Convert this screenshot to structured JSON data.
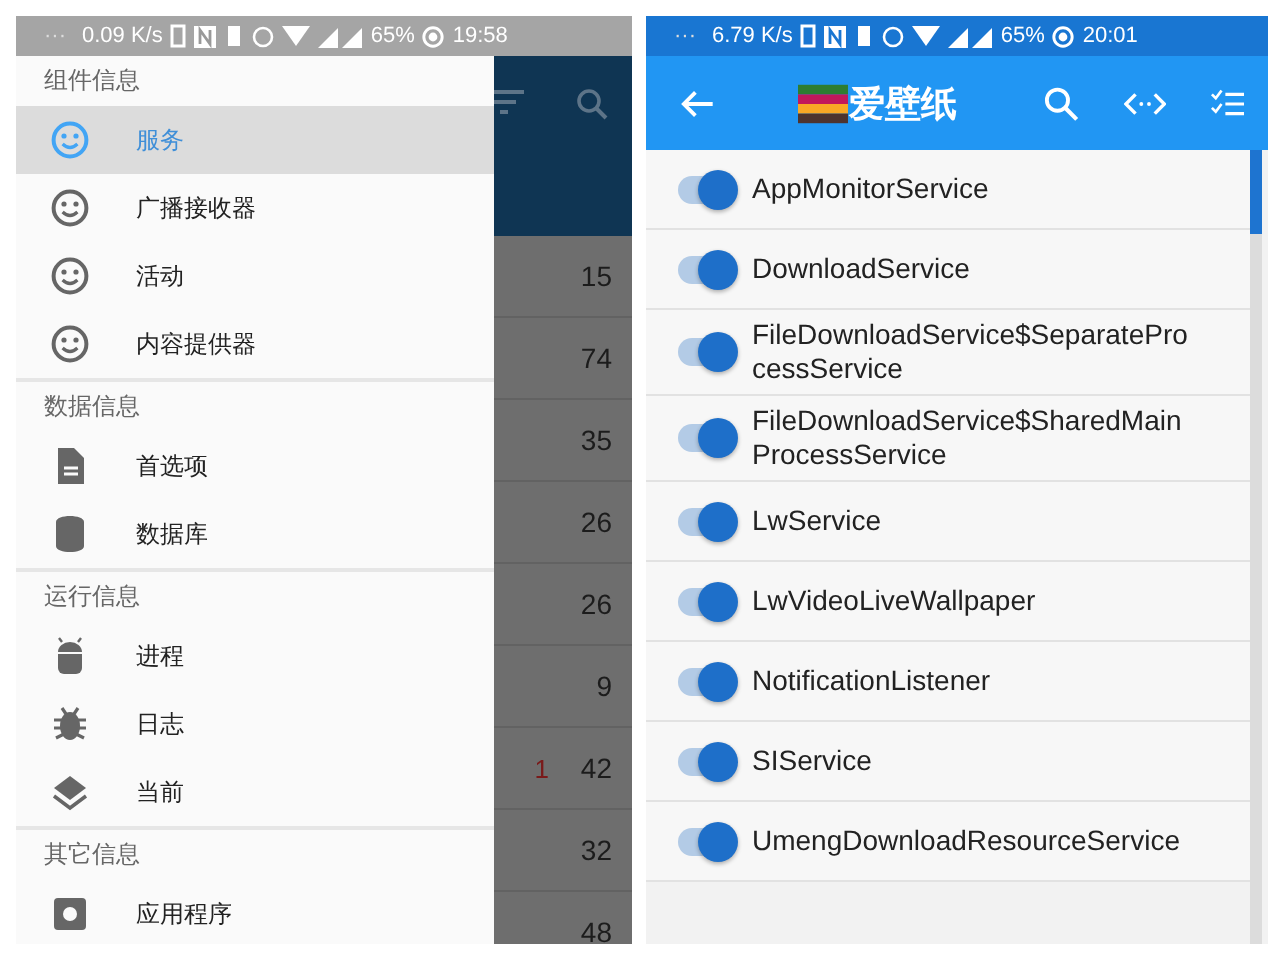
{
  "left_phone": {
    "status_bar": {
      "overflow": "···",
      "speed": "0.09 K/s",
      "battery": "65%",
      "time": "19:58"
    },
    "drawer": {
      "sections": [
        {
          "title": "组件信息",
          "items": [
            {
              "label": "服务",
              "kind": "smiley",
              "selected": true
            },
            {
              "label": "广播接收器",
              "kind": "smiley",
              "selected": false
            },
            {
              "label": "活动",
              "kind": "smiley",
              "selected": false
            },
            {
              "label": "内容提供器",
              "kind": "smiley",
              "selected": false
            }
          ]
        },
        {
          "title": "数据信息",
          "items": [
            {
              "label": "首选项",
              "kind": "document",
              "selected": false
            },
            {
              "label": "数据库",
              "kind": "database",
              "selected": false
            }
          ]
        },
        {
          "title": "运行信息",
          "items": [
            {
              "label": "进程",
              "kind": "android",
              "selected": false
            },
            {
              "label": "日志",
              "kind": "bug",
              "selected": false
            },
            {
              "label": "当前",
              "kind": "layers",
              "selected": false
            }
          ]
        },
        {
          "title": "其它信息",
          "items": [
            {
              "label": "应用程序",
              "kind": "settings",
              "selected": false
            }
          ]
        }
      ]
    },
    "background_list": {
      "rows": [
        {
          "count": "15"
        },
        {
          "count": "74"
        },
        {
          "count": "35"
        },
        {
          "count": "26"
        },
        {
          "count": "26"
        },
        {
          "count": "9"
        },
        {
          "badge": "1",
          "count": "42"
        },
        {
          "count": "32"
        },
        {
          "count": "48"
        }
      ]
    }
  },
  "right_phone": {
    "status_bar": {
      "overflow": "···",
      "speed": "6.79 K/s",
      "battery": "65%",
      "time": "20:01"
    },
    "app_bar": {
      "title": "爱壁纸"
    },
    "services": [
      {
        "name": "AppMonitorService",
        "on": true
      },
      {
        "name": "DownloadService",
        "on": true
      },
      {
        "name": "FileDownloadService$SeparateProcessService",
        "on": true
      },
      {
        "name": "FileDownloadService$SharedMainProcessService",
        "on": true
      },
      {
        "name": "LwService",
        "on": true
      },
      {
        "name": "LwVideoLiveWallpaper",
        "on": true
      },
      {
        "name": "NotificationListener",
        "on": true
      },
      {
        "name": "SIService",
        "on": true
      },
      {
        "name": "UmengDownloadResourceService",
        "on": true
      }
    ]
  }
}
